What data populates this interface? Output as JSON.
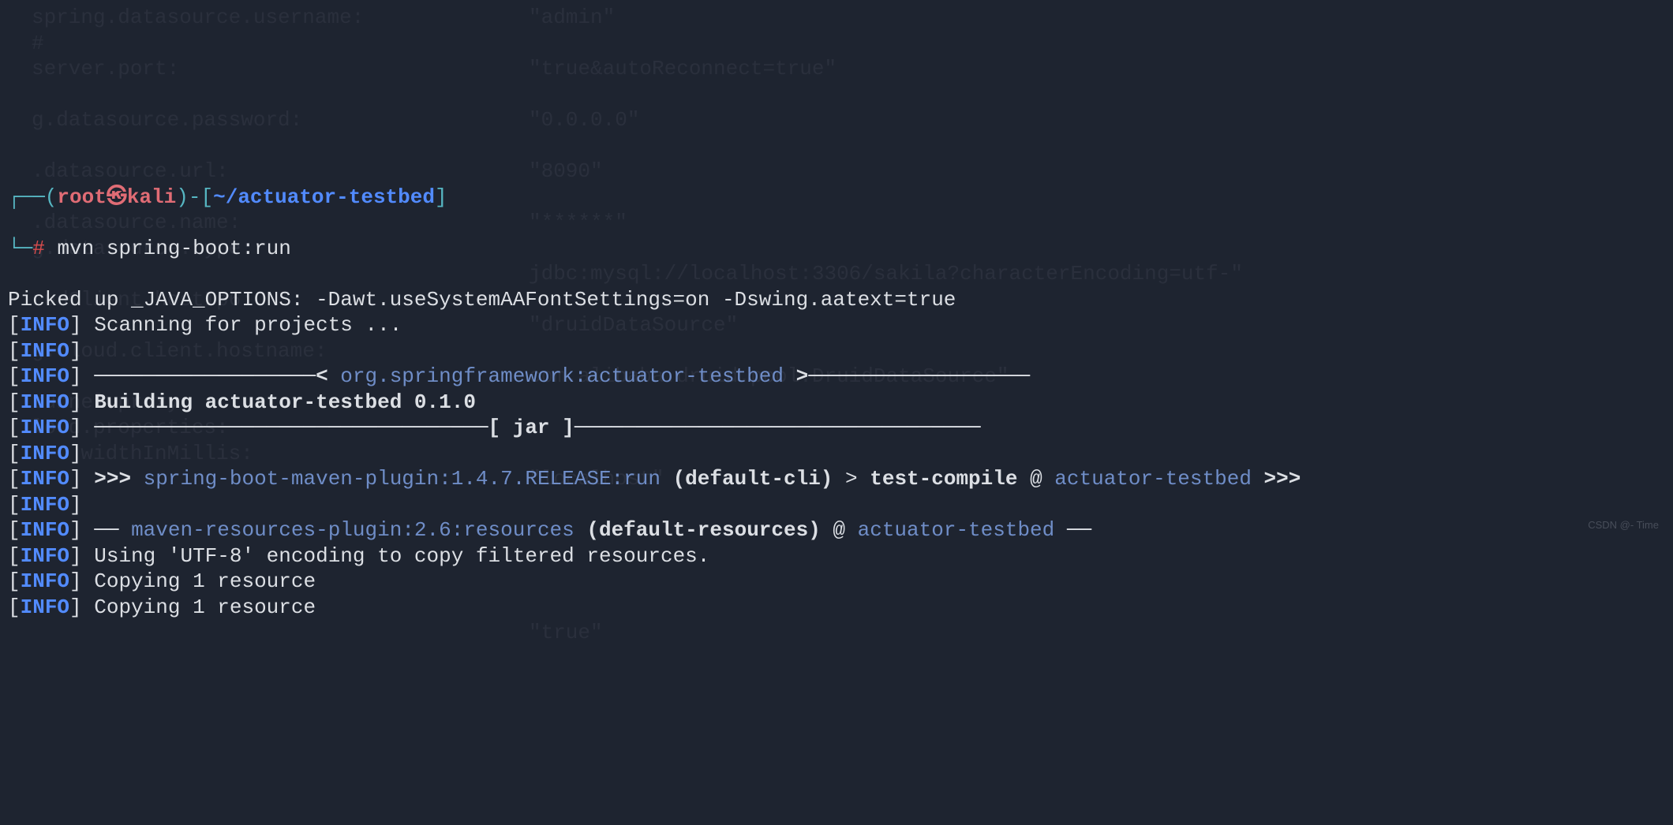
{
  "prompt": {
    "box_left": "┌──(",
    "user": "root",
    "skull": "㉿",
    "host": "kali",
    "paren_close": ")",
    "sep": "-[",
    "path": "~/actuator-testbed",
    "sep_close": "]",
    "box_bottom": "└─",
    "hash": "#",
    "command": "mvn spring-boot:run"
  },
  "lines": [
    {
      "type": "plain",
      "text": "Picked up _JAVA_OPTIONS: -Dawt.useSystemAAFontSettings=on -Dswing.aatext=true"
    },
    {
      "type": "info",
      "segments": [
        {
          "cls": "white",
          "text": " Scanning for projects ..."
        }
      ]
    },
    {
      "type": "info",
      "segments": []
    },
    {
      "type": "info",
      "segments": [
        {
          "cls": "whiteBold",
          "text": " ──────────────────< "
        },
        {
          "cls": "blueLight",
          "text": "org.springframework:actuator-testbed"
        },
        {
          "cls": "whiteBold",
          "text": " >──────────────────"
        }
      ]
    },
    {
      "type": "info",
      "segments": [
        {
          "cls": "whiteBold",
          "text": " Building actuator-testbed 0.1.0"
        }
      ]
    },
    {
      "type": "info",
      "segments": [
        {
          "cls": "whiteBold",
          "text": " ────────────────────────────────[ jar ]─────────────────────────────────"
        }
      ]
    },
    {
      "type": "info",
      "segments": []
    },
    {
      "type": "info",
      "segments": [
        {
          "cls": "whiteBold",
          "text": " >>> "
        },
        {
          "cls": "blueLight",
          "text": "spring-boot-maven-plugin:1.4.7.RELEASE:run "
        },
        {
          "cls": "whiteBold",
          "text": "(default-cli)"
        },
        {
          "cls": "white",
          "text": " > "
        },
        {
          "cls": "whiteBold",
          "text": "test-compile"
        },
        {
          "cls": "white",
          "text": " @ "
        },
        {
          "cls": "blueLight",
          "text": "actuator-testbed"
        },
        {
          "cls": "whiteBold",
          "text": " >>>"
        }
      ]
    },
    {
      "type": "info",
      "segments": []
    },
    {
      "type": "info",
      "segments": [
        {
          "cls": "whiteBold",
          "text": " ── "
        },
        {
          "cls": "blueLight",
          "text": "maven-resources-plugin:2.6:resources "
        },
        {
          "cls": "whiteBold",
          "text": "(default-resources)"
        },
        {
          "cls": "white",
          "text": " @ "
        },
        {
          "cls": "blueLight",
          "text": "actuator-testbed"
        },
        {
          "cls": "whiteBold",
          "text": " ──"
        }
      ]
    },
    {
      "type": "info",
      "segments": [
        {
          "cls": "white",
          "text": " Using 'UTF-8' encoding to copy filtered resources."
        }
      ]
    },
    {
      "type": "info",
      "segments": [
        {
          "cls": "white",
          "text": " Copying 1 resource"
        }
      ]
    },
    {
      "type": "info",
      "segments": [
        {
          "cls": "white",
          "text": " Copying 1 resource"
        }
      ]
    }
  ],
  "ghost": {
    "left": [
      "spring.datasource.username:",
      "#",
      "server.port:",
      "",
      "g.datasource.password:",
      "",
      ".datasource.url:",
      "",
      ".datasource.name:",
      "g.datasource.type:",
      "",
      "rudClient hostIp6:",
      "",
      "g.cloud.client.hostname:",
      "",
      "tunnel.proxy:",
      "loud.properties:",
      "    widthInMillis:"
    ],
    "right": [
      "\"admin\"",
      "",
      "\"true&autoReconnect=true\"",
      "",
      "\"0.0.0.0\"",
      "",
      "\"8090\"",
      "",
      "\"******\"",
      "",
      "jdbc:mysql://localhost:3306/sakila?characterEncoding=utf-\"",
      "",
      "\"druidDataSource\"",
      "",
      "com.alibaba.druid.pool.DruidDataSource\"",
      "",
      "",
      "",
      "\"localhost\"",
      "",
      "",
      "",
      "",
      "",
      "\"true\""
    ]
  },
  "watermark": "CSDN @- Time"
}
